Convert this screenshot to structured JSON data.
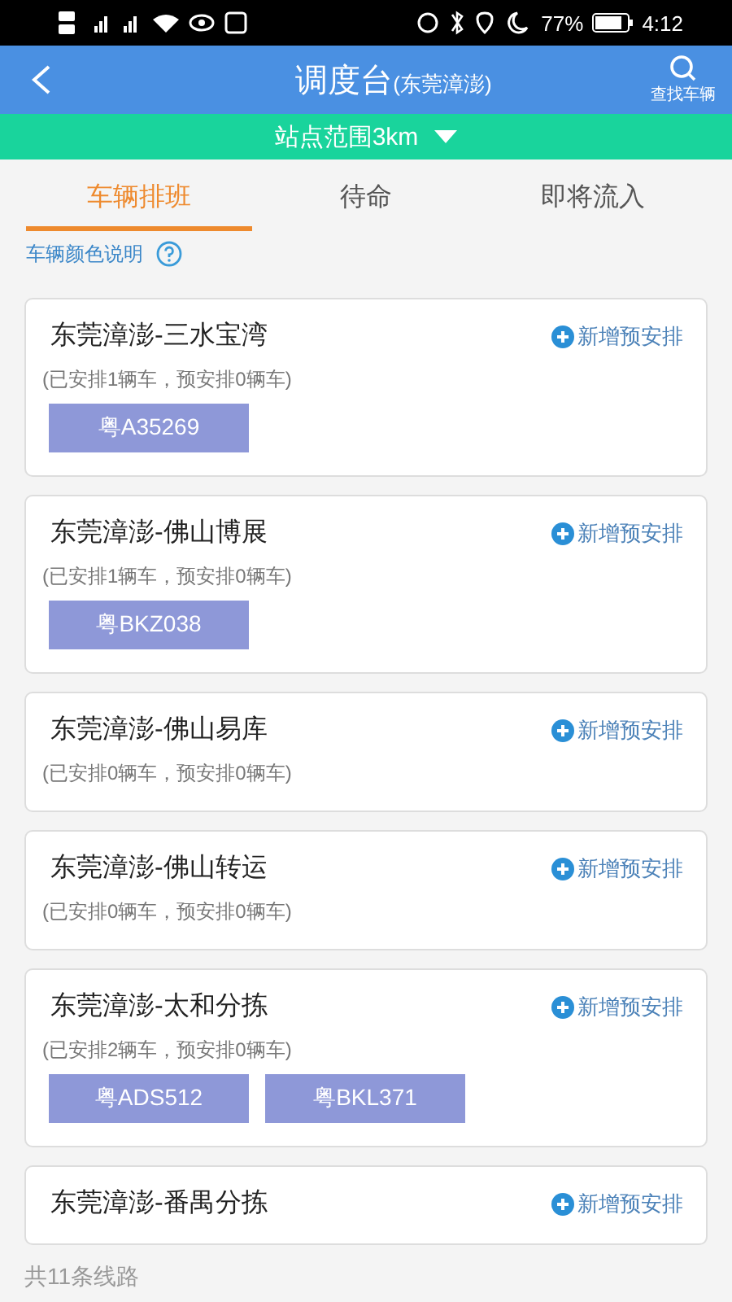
{
  "status_bar": {
    "battery": "77%",
    "time": "4:12"
  },
  "header": {
    "title": "调度台",
    "subtitle": "(东莞漳澎)",
    "search_label": "查找车辆"
  },
  "range_selector": {
    "label": "站点范围3km"
  },
  "tabs": [
    {
      "label": "车辆排班",
      "selected": true
    },
    {
      "label": "待命",
      "selected": false
    },
    {
      "label": "即将流入",
      "selected": false
    }
  ],
  "legend_link": "车辆颜色说明",
  "routes": [
    {
      "name": "东莞漳澎-三水宝湾",
      "action": "新增预安排",
      "summary": "(已安排1辆车，预安排0辆车)",
      "plates": [
        "粤A35269"
      ]
    },
    {
      "name": "东莞漳澎-佛山博展",
      "action": "新增预安排",
      "summary": "(已安排1辆车，预安排0辆车)",
      "plates": [
        "粤BKZ038"
      ]
    },
    {
      "name": "东莞漳澎-佛山易库",
      "action": "新增预安排",
      "summary": "(已安排0辆车，预安排0辆车)"
    },
    {
      "name": "东莞漳澎-佛山转运",
      "action": "新增预安排",
      "summary": "(已安排0辆车，预安排0辆车)"
    },
    {
      "name": "东莞漳澎-太和分拣",
      "action": "新增预安排",
      "summary": "(已安排2辆车，预安排0辆车)",
      "plates": [
        "粤ADS512",
        "粤BKL371"
      ]
    },
    {
      "name": "东莞漳澎-番禺分拣",
      "action": "新增预安排"
    }
  ],
  "footer": "共11条线路"
}
